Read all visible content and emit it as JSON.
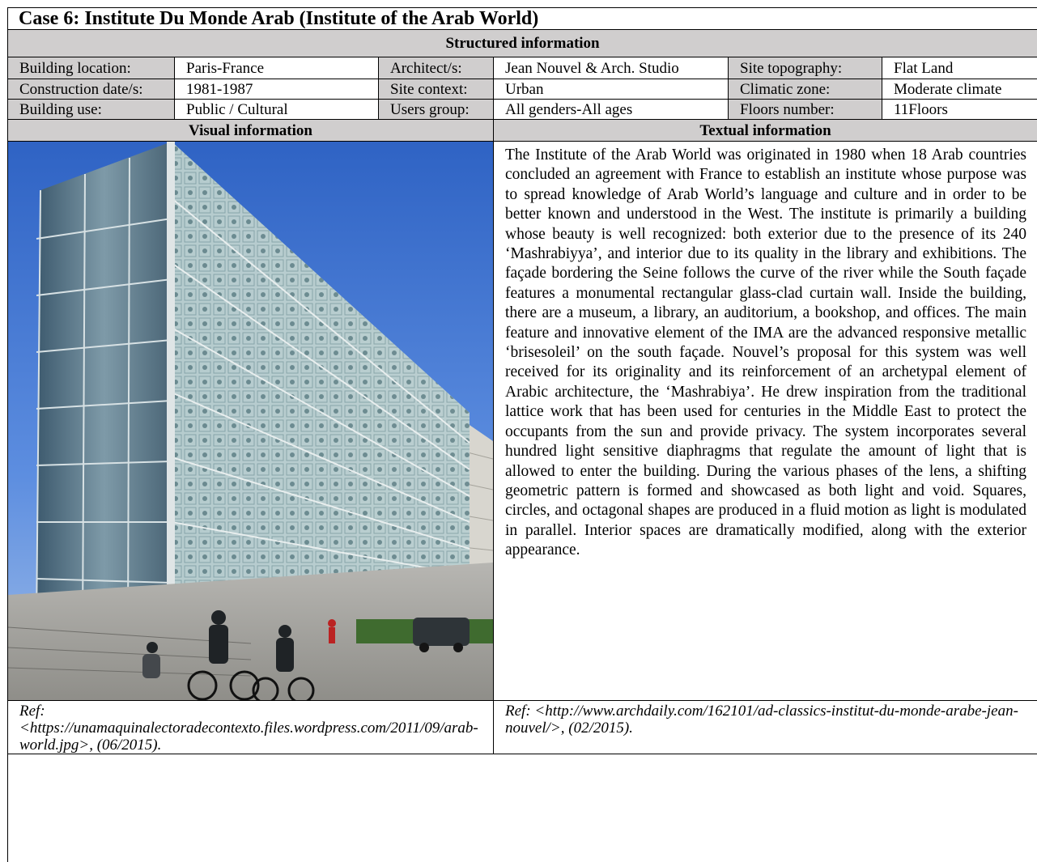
{
  "title": "Case 6: Institute Du Monde Arab (Institute of the Arab World)",
  "structured_heading": "Structured information",
  "info_rows": [
    [
      {
        "label": "Building location:",
        "value": "Paris-France"
      },
      {
        "label": "Architect/s:",
        "value": "Jean Nouvel & Arch. Studio"
      },
      {
        "label": "Site topography:",
        "value": "Flat Land"
      }
    ],
    [
      {
        "label": "Construction date/s:",
        "value": "1981-1987"
      },
      {
        "label": "Site context:",
        "value": "Urban"
      },
      {
        "label": "Climatic zone:",
        "value": "Moderate climate"
      }
    ],
    [
      {
        "label": "Building use:",
        "value": "Public / Cultural"
      },
      {
        "label": "Users group:",
        "value": "All genders-All ages"
      },
      {
        "label": "Floors number:",
        "value": "11Floors"
      }
    ]
  ],
  "visual_heading": "Visual information",
  "textual_heading": "Textual information",
  "photo_alt": "Photograph of the Institute of the Arab World glass façade with people and bicycles in the foreground",
  "description": "The Institute of the Arab World was originated in 1980 when 18 Arab countries concluded an agreement with France to establish an institute whose purpose was to spread knowledge of Arab World’s language and culture and in order to be better known and understood in the West. The institute is primarily a building whose beauty is well recognized: both exterior due to the presence of its 240 ‘Mashrabiyya’, and interior due to its quality in the library and exhibitions. The façade bordering the Seine follows the curve of the river while the South façade features a monumental rectangular glass-clad curtain wall. Inside the building, there are a museum, a library, an auditorium, a bookshop, and offices. The main feature and innovative element of the IMA are the advanced responsive metallic ‘brisesoleil’ on the south façade. Nouvel’s proposal for this system was well received for its originality and its reinforcement of an archetypal element of Arabic architecture, the ‘Mashrabiya’. He drew inspiration from the traditional lattice work that has been used for centuries in the Middle East to protect the occupants from the sun and provide privacy. The system incorporates several hundred light sensitive diaphragms that regulate the amount of light that is allowed to enter the building. During the various phases of the lens, a shifting geometric pattern is formed and showcased as both light and void. Squares, circles, and octagonal shapes are produced in a fluid motion as light is modulated in parallel. Interior spaces are dramatically modified, along with the exterior appearance.",
  "ref_visual": "Ref:<https://unamaquinalectoradecontexto.files.wordpress.com/2011/09/arab-world.jpg>, (06/2015).",
  "ref_textual": "Ref: <http://www.archdaily.com/162101/ad-classics-institut-du-monde-arabe-jean-nouvel/>, (02/2015)."
}
